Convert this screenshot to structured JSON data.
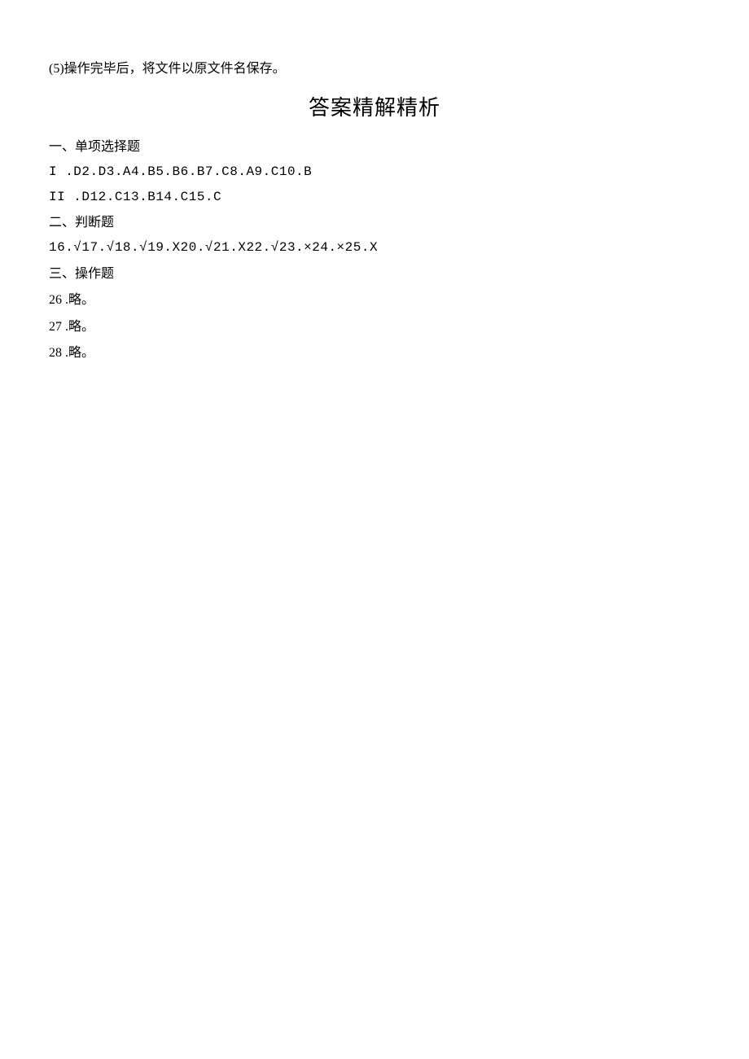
{
  "line1": "(5)操作完毕后，将文件以原文件名保存。",
  "title": "答案精解精析",
  "section1": {
    "header": "一、单项选择题",
    "line1": "I .D2.D3.A4.B5.B6.B7.C8.A9.C10.B",
    "line2": "II .D12.C13.B14.C15.C"
  },
  "section2": {
    "header": "二、判断题",
    "line1": "16.√17.√18.√19.X20.√21.X22.√23.×24.×25.X"
  },
  "section3": {
    "header": "三、操作题",
    "item1": "26 .略。",
    "item2": "27 .略。",
    "item3": "28 .略。"
  }
}
